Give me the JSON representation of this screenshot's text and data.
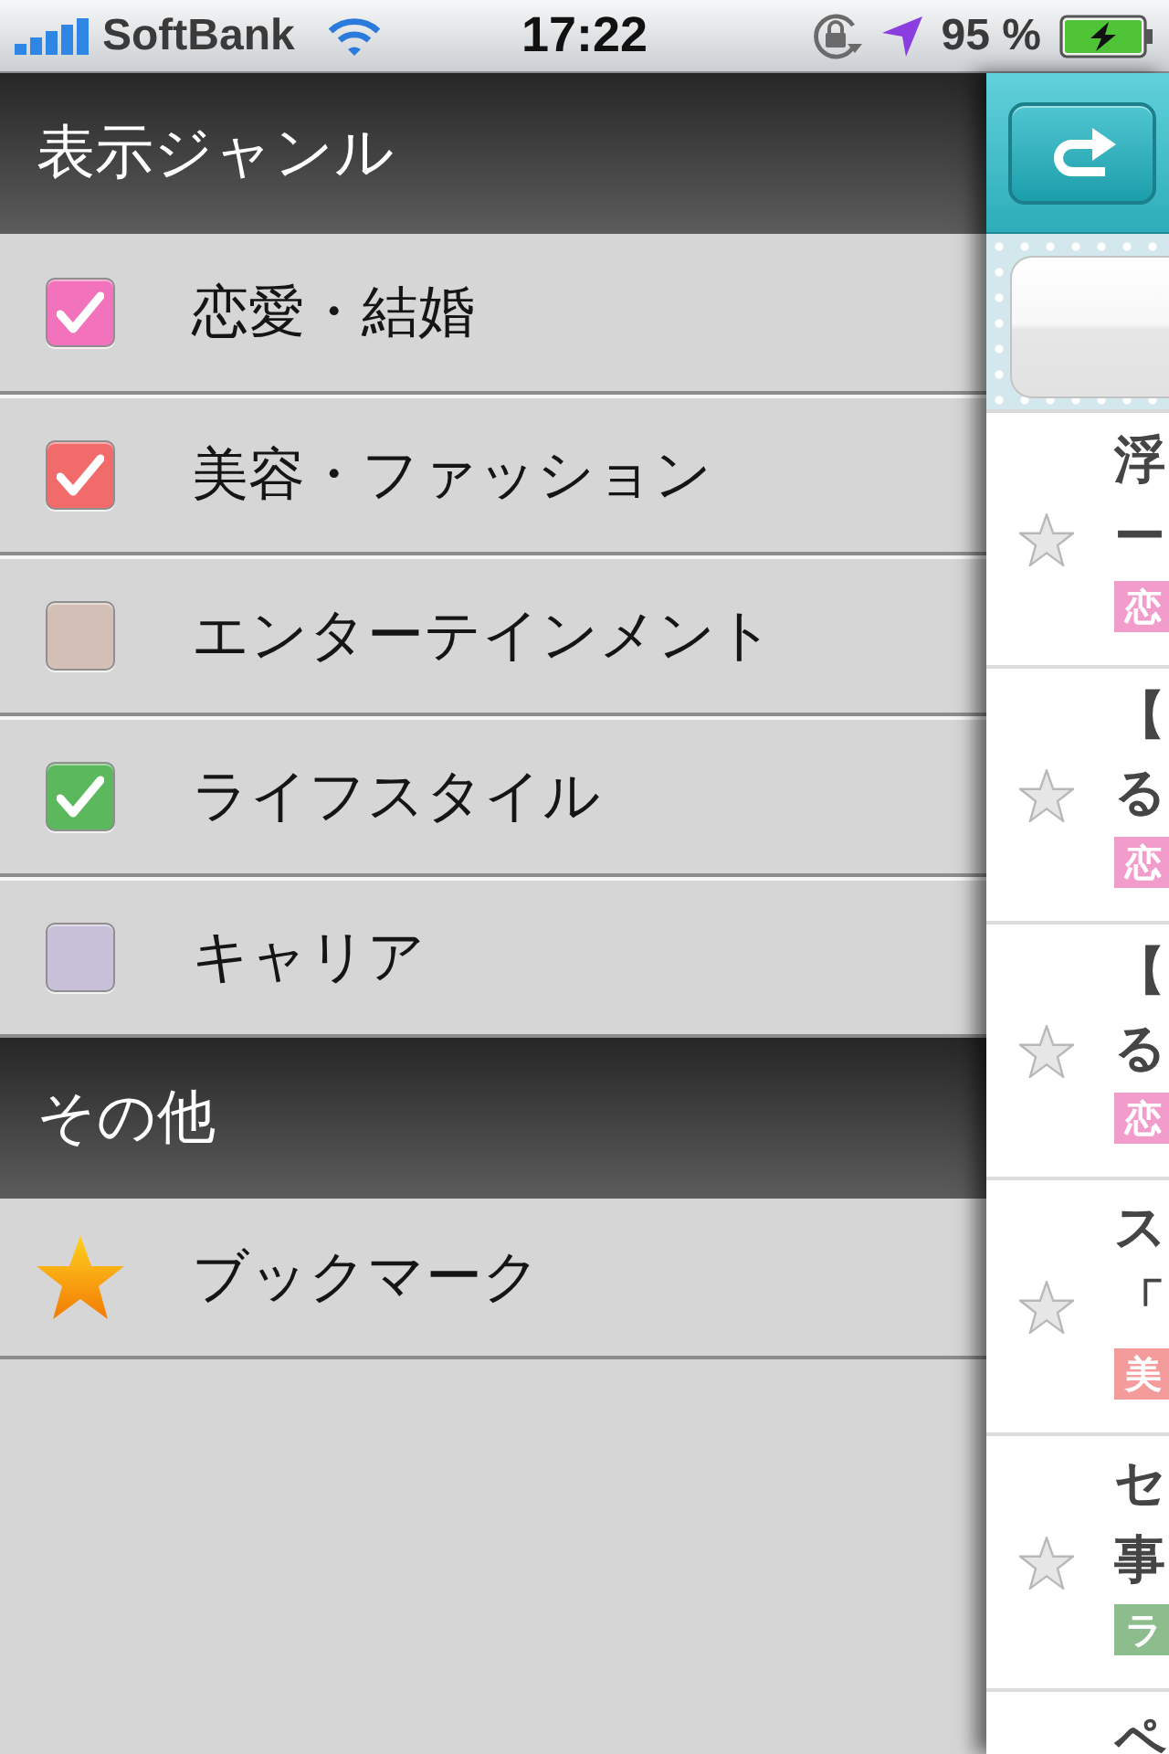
{
  "status_bar": {
    "carrier": "SoftBank",
    "time": "17:22",
    "battery": "95 %"
  },
  "menu": [
    {
      "title": "表示ジャンル",
      "items": [
        {
          "kind": "checkbox",
          "label": "恋愛・結婚",
          "checked": true,
          "color": "#f272bb"
        },
        {
          "kind": "checkbox",
          "label": "美容・ファッション",
          "checked": true,
          "color": "#f26b6b"
        },
        {
          "kind": "checkbox",
          "label": "エンターテインメント",
          "checked": false,
          "color": "#d4bfb7"
        },
        {
          "kind": "checkbox",
          "label": "ライフスタイル",
          "checked": true,
          "color": "#5cb85c"
        },
        {
          "kind": "checkbox",
          "label": "キャリア",
          "checked": false,
          "color": "#c8bfd8"
        }
      ]
    },
    {
      "title": "その他",
      "items": [
        {
          "kind": "bookmark",
          "label": "ブックマーク"
        }
      ]
    }
  ],
  "content": {
    "articles": [
      {
        "title_lines": [
          "浮",
          "ー"
        ],
        "bookmarked": false,
        "tag": {
          "label": "恋",
          "color": "#f29ccc"
        }
      },
      {
        "title_lines": [
          "【",
          "る"
        ],
        "bookmarked": false,
        "tag": {
          "label": "恋",
          "color": "#f29ccc"
        }
      },
      {
        "title_lines": [
          "【",
          "る"
        ],
        "bookmarked": false,
        "tag": {
          "label": "恋",
          "color": "#f29ccc"
        }
      },
      {
        "title_lines": [
          "ス",
          "「"
        ],
        "bookmarked": false,
        "tag": {
          "label": "美",
          "color": "#f49c9c"
        }
      },
      {
        "title_lines": [
          "セ",
          "事"
        ],
        "bookmarked": false,
        "tag": {
          "label": "ラ",
          "color": "#8dbd8d"
        }
      },
      {
        "title_lines": [
          "ペ"
        ]
      }
    ]
  }
}
